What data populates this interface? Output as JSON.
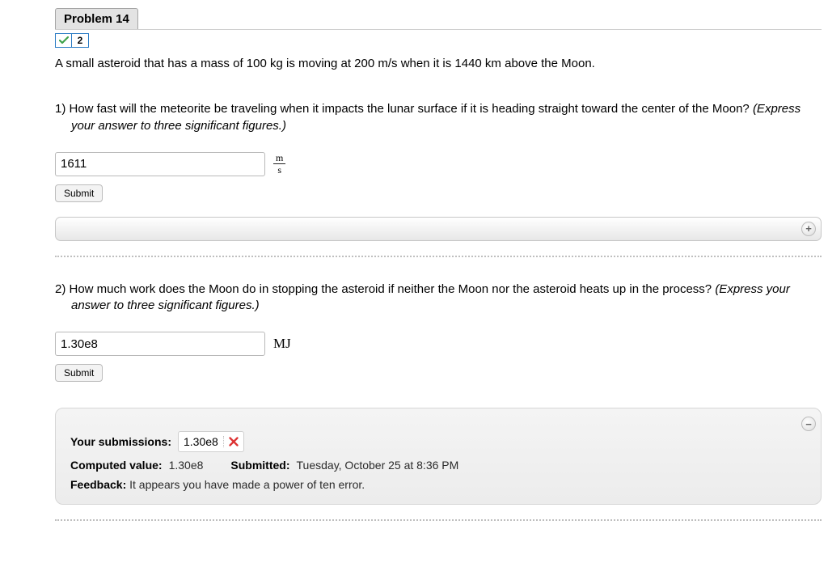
{
  "problem": {
    "title": "Problem 14",
    "attempt_badge": "2"
  },
  "intro": "A small asteroid that has a mass of 100 kg is moving at 200 m/s when it is 1440 km above the Moon.",
  "q1": {
    "text": "1) How fast will the meteorite be traveling when it impacts the lunar surface if it is heading straight toward the center of the Moon? ",
    "hint": "(Express your answer to three significant figures.)",
    "value": "1611",
    "unit_num": "m",
    "unit_den": "s",
    "submit": "Submit",
    "expand_icon": "+"
  },
  "q2": {
    "text": "2) How much work does the Moon do in stopping the asteroid if neither the Moon nor the asteroid heats up in the process? ",
    "hint": "(Express your answer to three significant figures.)",
    "value": "1.30e8",
    "unit": "MJ",
    "submit": "Submit",
    "collapse_icon": "−"
  },
  "feedback": {
    "your_submissions_label": "Your submissions:",
    "chip_value": "1.30e8",
    "computed_label": "Computed value:",
    "computed_value": "1.30e8",
    "submitted_label": "Submitted:",
    "submitted_value": "Tuesday, October 25 at 8:36 PM",
    "feedback_label": "Feedback:",
    "feedback_text": "It appears you have made a power of ten error."
  }
}
